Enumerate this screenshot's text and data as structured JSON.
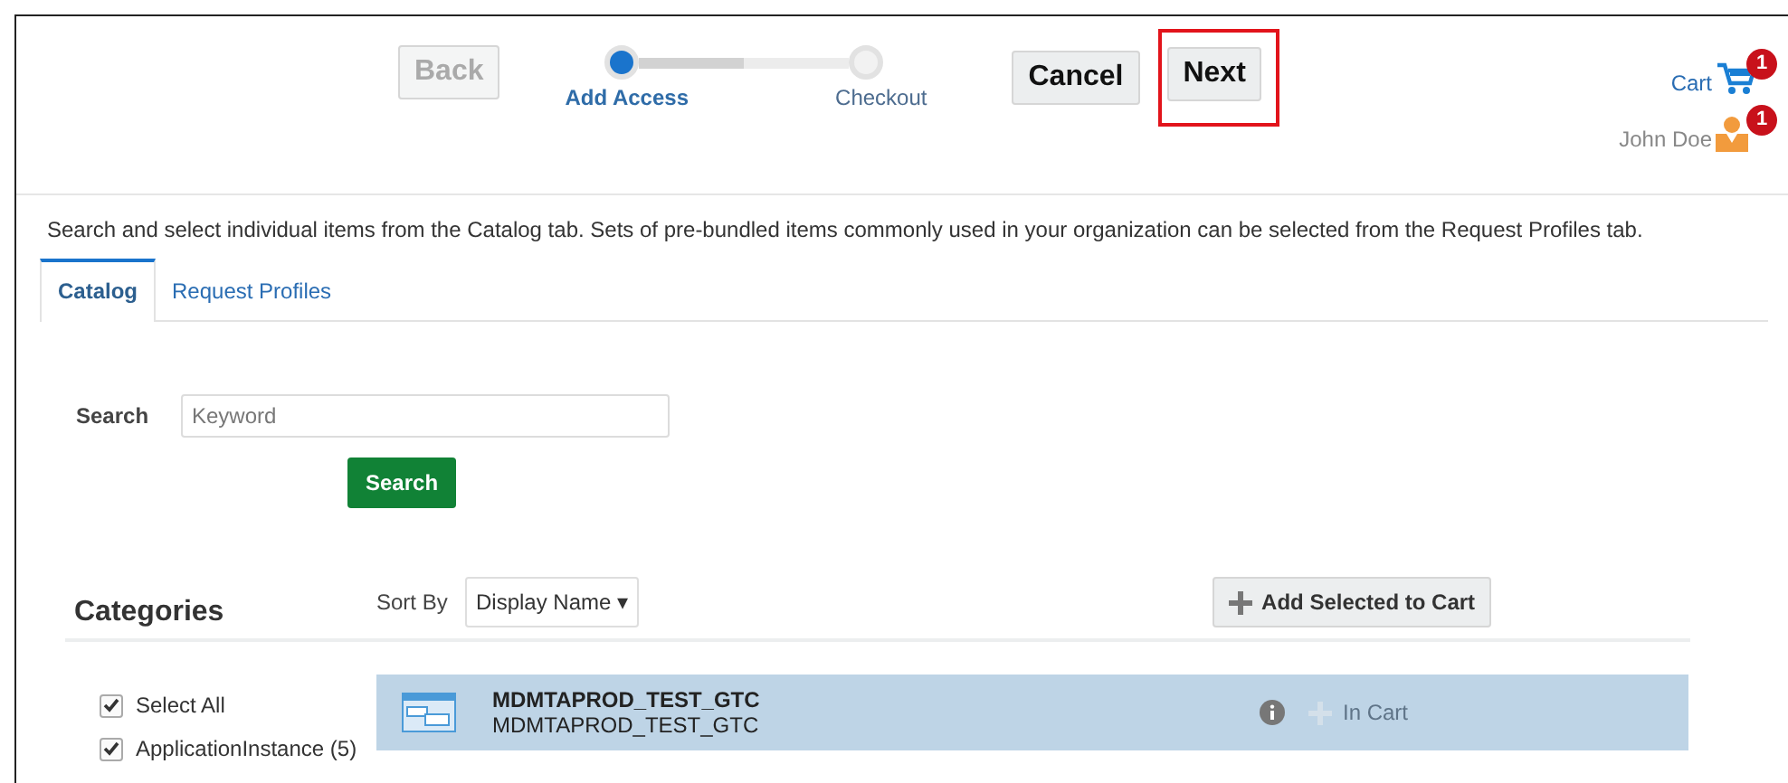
{
  "header": {
    "back": {
      "label": "Back",
      "disabled": true
    },
    "steps": [
      {
        "label": "Add Access",
        "selected": true
      },
      {
        "label": "Checkout",
        "selected": false
      }
    ],
    "buttons": [
      {
        "label": "Cancel",
        "highlighted": false
      },
      {
        "label": "Next",
        "highlighted": true
      }
    ],
    "cart": {
      "label": "Cart",
      "badge": "1"
    },
    "user": {
      "name": "John Doe",
      "badge": "1"
    }
  },
  "description": "Search and select individual items from the Catalog tab. Sets of pre-bundled items commonly used in your organization can be selected from the Request Profiles tab.",
  "tabs": [
    {
      "label": "Catalog",
      "selected": true
    },
    {
      "label": "Request Profiles",
      "selected": false
    }
  ],
  "search": {
    "label": "Search",
    "placeholder": "Keyword",
    "button": "Search"
  },
  "categories": {
    "title": "Categories",
    "items": [
      {
        "label": "Select All",
        "checked": true
      },
      {
        "label": "ApplicationInstance (5)",
        "checked": true
      }
    ]
  },
  "sort": {
    "label": "Sort By",
    "value": "Display Name ▾"
  },
  "add_button": "Add Selected to Cart",
  "results": [
    {
      "title": "MDMTAPROD_TEST_GTC",
      "subtitle": "MDMTAPROD_TEST_GTC",
      "selected": true,
      "action": "In Cart",
      "in_cart": true
    }
  ]
}
